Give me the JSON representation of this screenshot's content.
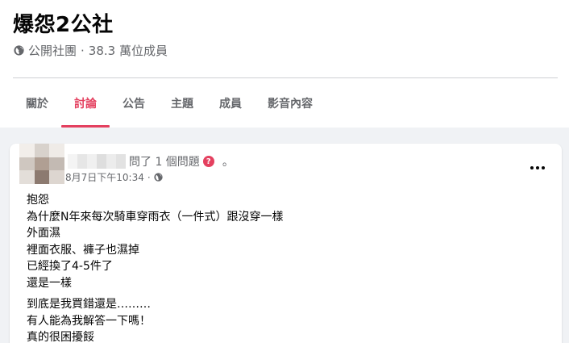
{
  "group": {
    "title": "爆怨2公社",
    "privacy_label": "公開社團",
    "separator": "·",
    "member_count": "38.3 萬位成員"
  },
  "tabs": [
    {
      "label": "關於",
      "active": false
    },
    {
      "label": "討論",
      "active": true
    },
    {
      "label": "公告",
      "active": false
    },
    {
      "label": "主題",
      "active": false
    },
    {
      "label": "成員",
      "active": false
    },
    {
      "label": "影音內容",
      "active": false
    }
  ],
  "post": {
    "action_text": "問了 1 個問題",
    "question_icon_glyph": "?",
    "trailing_dot": "。",
    "timestamp": "8月7日下午10:34",
    "meta_separator": "·",
    "privacy_icon": "globe-icon",
    "body_paragraphs": [
      [
        "抱怨",
        "為什麼N年來每次騎車穿雨衣（一件式）跟沒穿一樣",
        "外面濕",
        "裡面衣服、褲子也濕掉",
        "已經換了4-5件了",
        "還是一樣"
      ],
      [
        "到底是我買錯還是………",
        "有人能為我解答一下嗎！",
        "真的很困擾餒"
      ]
    ]
  },
  "colors": {
    "accent": "#e4405f",
    "page_background": "#f0f2f5",
    "secondary_text": "#65676b"
  }
}
